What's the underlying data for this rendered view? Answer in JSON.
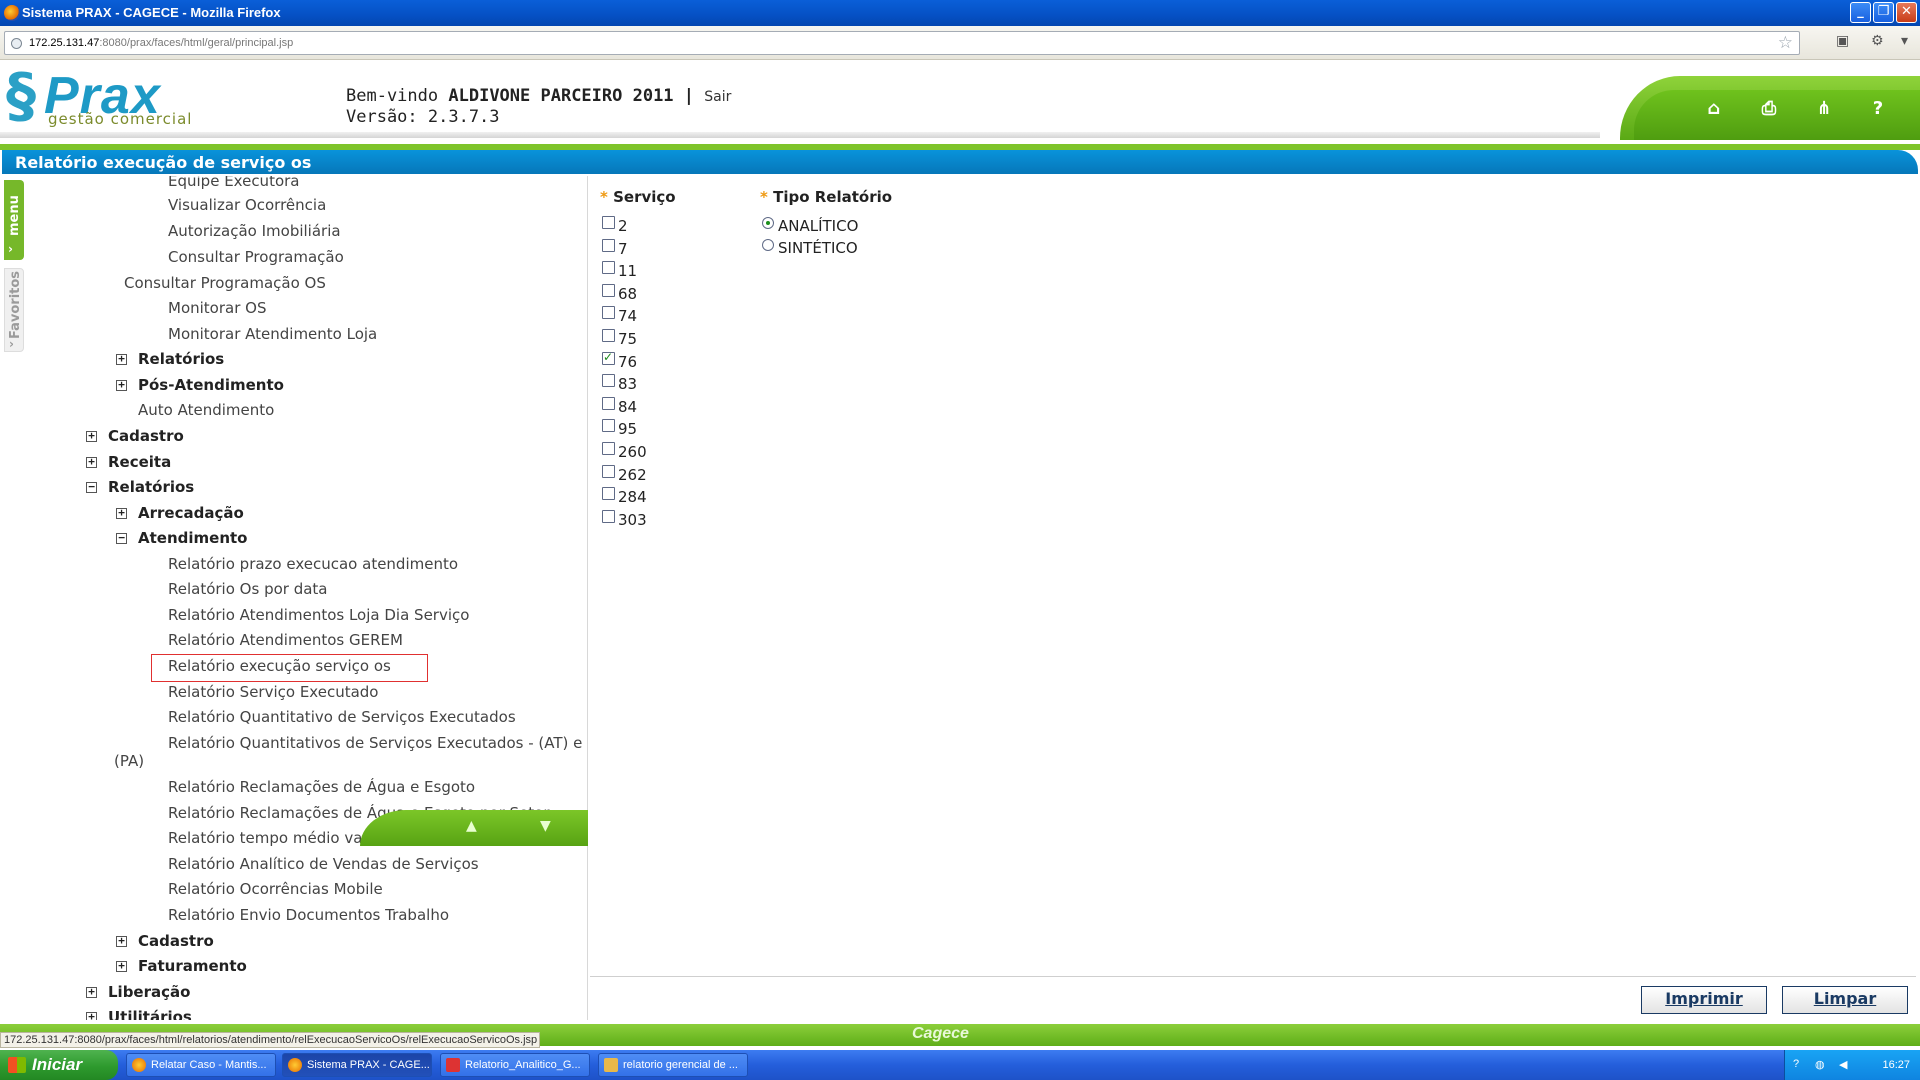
{
  "browser": {
    "title": "Sistema PRAX - CAGECE - Mozilla Firefox",
    "url_host": "172.25.131.47",
    "url_rest": ":8080/prax/faces/html/geral/principal.jsp"
  },
  "header": {
    "brand": "Prax",
    "brand_sub": "gestão comercial",
    "welcome_prefix": "Bem-vindo",
    "user": "ALDIVONE PARCEIRO 2011",
    "separator": "|",
    "logout": "Sair",
    "version": "Versão: 2.3.7.3"
  },
  "page_title": "Relatório execução de serviço os",
  "side_tabs": {
    "menu": "menu",
    "favoritos": "Favoritos"
  },
  "tree": {
    "items": [
      "Equipe Executora",
      "Visualizar Ocorrência",
      "Autorização Imobiliária",
      "Consultar Programação",
      "Consultar Programação OS",
      "Monitorar OS",
      "Monitorar Atendimento Loja",
      "Relatórios",
      "Pós-Atendimento",
      "Auto Atendimento",
      "Cadastro",
      "Receita",
      "Relatórios",
      "Arrecadação",
      "Atendimento",
      "Relatório prazo execucao atendimento",
      "Relatório Os por data",
      "Relatório Atendimentos Loja Dia Serviço",
      "Relatório Atendimentos GEREM",
      "Relatório execução serviço os",
      "Relatório Serviço Executado",
      "Relatório Quantitativo de Serviços Executados",
      "Relatório Quantitativos de Serviços Executados - (AT) e",
      "(PA)",
      "Relatório Reclamações de Água e Esgoto",
      "Relatório Reclamações de Água e Esgoto por Setor",
      "Relatório tempo médio vazamento",
      "Relatório Analítico de Vendas de Serviços",
      "Relatório Ocorrências Mobile",
      "Relatório Envio Documentos Trabalho",
      "Cadastro",
      "Faturamento",
      "Liberação",
      "Utilitários"
    ]
  },
  "form": {
    "required_mark": "*",
    "servico_label": "Serviço",
    "servico_options": [
      "2",
      "7",
      "11",
      "68",
      "74",
      "75",
      "76",
      "83",
      "84",
      "95",
      "260",
      "262",
      "284",
      "303"
    ],
    "servico_checked": [
      "76"
    ],
    "tipo_label": "Tipo Relatório",
    "tipo_options": [
      "ANALÍTICO",
      "SINTÉTICO"
    ],
    "tipo_selected": "ANALÍTICO",
    "btn_print": "Imprimir",
    "btn_clear": "Limpar"
  },
  "footer": {
    "brand": "Cagece"
  },
  "status_bar": "172.25.131.47:8080/prax/faces/html/relatorios/atendimento/relExecucaoServicoOs/relExecucaoServicoOs.jsp",
  "taskbar": {
    "start": "Iniciar",
    "tasks": [
      "Relatar Caso - Mantis...",
      "Sistema PRAX - CAGE...",
      "Relatorio_Analitico_G...",
      "relatorio gerencial de ..."
    ],
    "clock": "16:27"
  }
}
